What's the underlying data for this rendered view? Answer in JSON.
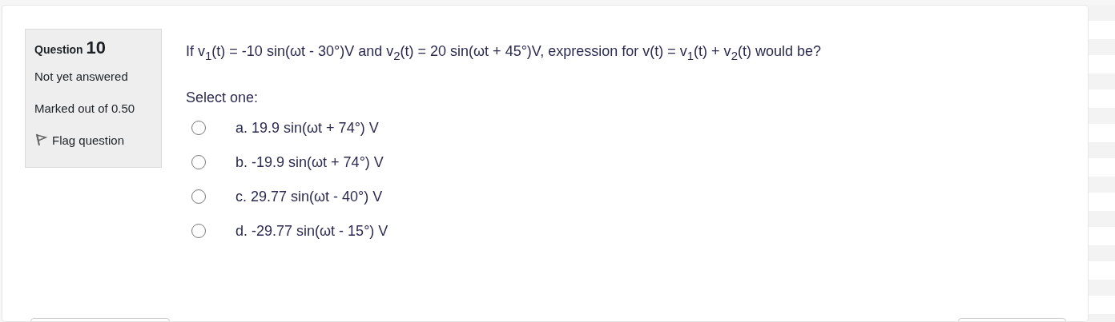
{
  "question_info": {
    "label": "Question",
    "number": "10",
    "state": "Not yet answered",
    "marks": "Marked out of 0.50",
    "flag": {
      "label": "Flag question",
      "flagged": false
    }
  },
  "question": {
    "text": "If v$_{1}$(t) = -10 sin(ωt - 30°)V and v$_{2}$(t) = 20 sin(ωt + 45°)V, expression for v(t) = v$_{1}$(t) + v$_{2}$(t) would be?",
    "prompt": "Select one:",
    "options": [
      {
        "label": "a. 19.9 sin(ωt + 74°) V",
        "selected": false
      },
      {
        "label": "b. -19.9 sin(ωt + 74°) V",
        "selected": false
      },
      {
        "label": "c. 29.77 sin(ωt - 40°) V",
        "selected": false
      },
      {
        "label": "d. -29.77 sin(ωt - 15°) V",
        "selected": false
      }
    ]
  }
}
